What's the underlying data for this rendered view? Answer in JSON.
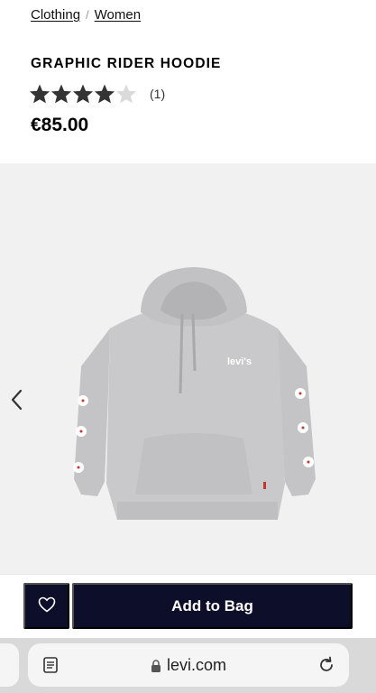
{
  "breadcrumb": {
    "items": [
      "Clothing",
      "Women"
    ],
    "separator": "/"
  },
  "product": {
    "title": "GRAPHIC RIDER HOODIE",
    "rating": 4,
    "rating_max": 5,
    "review_count": "(1)",
    "price": "€85.00",
    "image_alt_logo": "levi's"
  },
  "gallery": {
    "prev_icon": "chevron-left-icon"
  },
  "actions": {
    "wishlist_icon": "heart-outline-icon",
    "add_to_bag_label": "Add to Bag"
  },
  "browser": {
    "url": "levi.com",
    "reader_icon": "reader-mode-icon",
    "lock_icon": "lock-icon",
    "reload_icon": "reload-icon"
  },
  "colors": {
    "navy": "#0d0f2a",
    "gallery_bg": "#f1f1f1",
    "star_filled": "#333333",
    "star_empty": "#d9d9d9"
  }
}
